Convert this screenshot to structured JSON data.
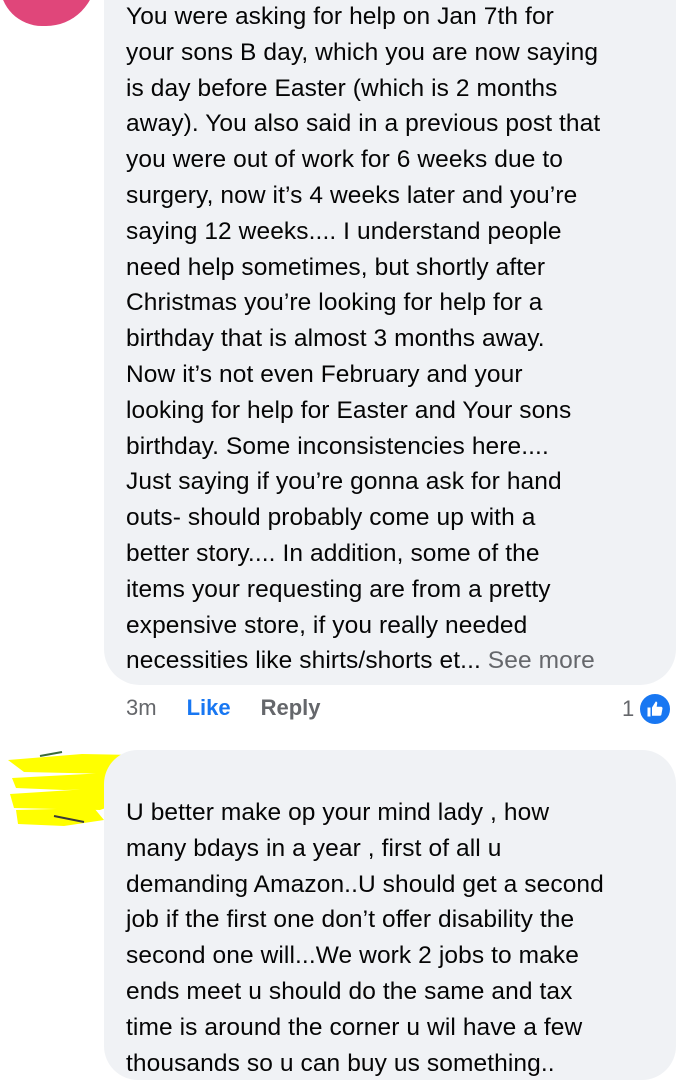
{
  "comments": [
    {
      "text": "You were asking for help on Jan 7th for\nyour sons B day, which you are now saying\nis day before Easter (which is 2 months\naway).  You also said in a previous post that\nyou were out of work for 6 weeks due to\nsurgery, now it’s 4 weeks later and you’re\nsaying 12 weeks....  I understand people\nneed help sometimes, but shortly after\nChristmas you’re looking for help for a\nbirthday that is almost 3 months away.\nNow it’s not even February and your\nlooking for help for Easter and Your sons\nbirthday.  Some inconsistencies here....\nJust saying if you’re gonna ask for hand\nouts- should probably come up with a\nbetter story.... In addition, some of the\nitems your requesting are from a pretty\nexpensive store, if you really needed\nnecessities like shirts/shorts et... ",
      "see_more": "See more",
      "timestamp": "3m",
      "like_label": "Like",
      "reply_label": "Reply",
      "reaction_count": "1",
      "reaction_icon": "thumbs-up-icon"
    },
    {
      "text": "U better make op your mind lady , how\nmany bdays in a year , first of all u\ndemanding Amazon..U should get a second\njob if the first one don’t offer disability the\nsecond one will...We work 2 jobs to make\nends meet u should do the same and tax\ntime is around the corner u wil have a few\nthousands so u can buy us something.."
    }
  ],
  "colors": {
    "bubble_bg": "#f0f2f5",
    "accent_blue": "#1877f2",
    "muted_text": "#65676b",
    "redaction_yellow": "#ffff00",
    "avatar_pink": "#e0467a"
  }
}
